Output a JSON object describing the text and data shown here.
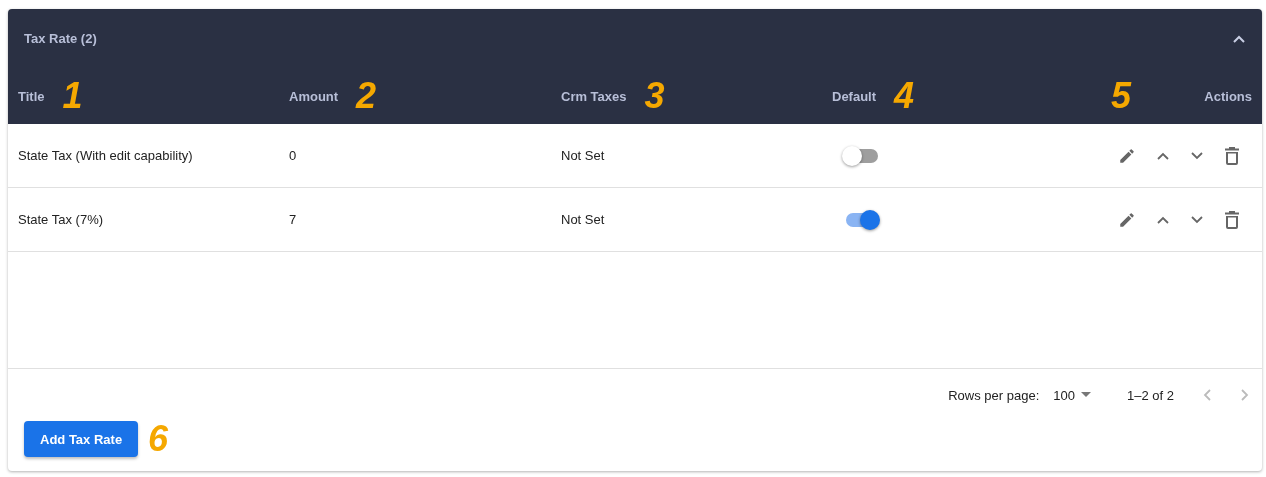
{
  "panel": {
    "title": "Tax Rate (2)",
    "expanded": true
  },
  "table": {
    "columns": [
      {
        "label": "Title",
        "callout": "1"
      },
      {
        "label": "Amount",
        "callout": "2"
      },
      {
        "label": "Crm Taxes",
        "callout": "3"
      },
      {
        "label": "Default",
        "callout": "4"
      },
      {
        "label": "Actions",
        "callout": "5"
      }
    ],
    "rows": [
      {
        "title": "State Tax (With edit capability)",
        "amount": "0",
        "crm_taxes": "Not Set",
        "default": false
      },
      {
        "title": "State Tax (7%)",
        "amount": "7",
        "crm_taxes": "Not Set",
        "default": true
      }
    ]
  },
  "pagination": {
    "rows_per_page_label": "Rows per page:",
    "rows_per_page": "100",
    "range": "1–2 of 2"
  },
  "add_button": {
    "label": "Add Tax Rate",
    "callout": "6"
  }
}
